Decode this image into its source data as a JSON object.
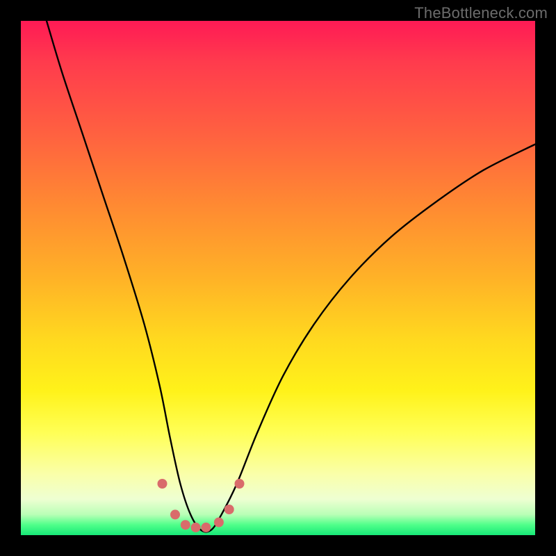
{
  "watermark": "TheBottleneck.com",
  "chart_data": {
    "type": "line",
    "title": "",
    "xlabel": "",
    "ylabel": "",
    "xlim": [
      0,
      100
    ],
    "ylim": [
      0,
      100
    ],
    "series": [
      {
        "name": "bottleneck-curve",
        "x": [
          5,
          8,
          12,
          16,
          20,
          24,
          27,
          29,
          31,
          33,
          35,
          37,
          39,
          42,
          46,
          51,
          57,
          64,
          72,
          81,
          90,
          100
        ],
        "values": [
          100,
          90,
          78,
          66,
          54,
          41,
          29,
          19,
          10,
          4,
          1,
          1,
          4,
          10,
          20,
          31,
          41,
          50,
          58,
          65,
          71,
          76
        ]
      }
    ],
    "markers": {
      "name": "highlight-dots",
      "x": [
        27.5,
        30,
        32,
        34,
        36,
        38.5,
        40.5,
        42.5
      ],
      "values": [
        10,
        4,
        2,
        1.5,
        1.5,
        2.5,
        5,
        10
      ],
      "color": "#d96b6b",
      "radius_px": 7
    },
    "gradient_stops": [
      {
        "pos": 0.0,
        "color": "#ff1a55"
      },
      {
        "pos": 0.36,
        "color": "#ff8a32"
      },
      {
        "pos": 0.72,
        "color": "#fff21a"
      },
      {
        "pos": 0.96,
        "color": "#b9ffb6"
      },
      {
        "pos": 1.0,
        "color": "#17e877"
      }
    ]
  }
}
